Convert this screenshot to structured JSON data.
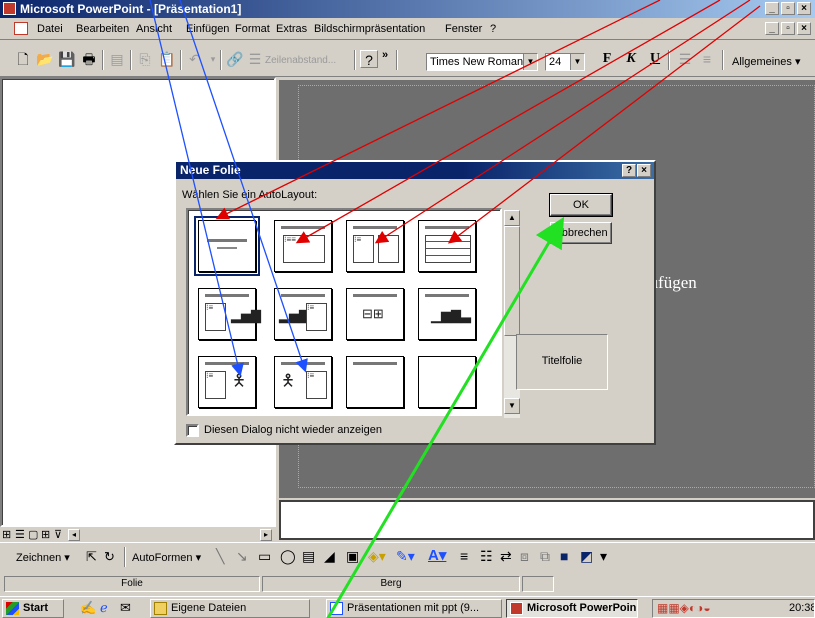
{
  "window": {
    "title": "Microsoft PowerPoint - [Präsentation1]",
    "controls": [
      "_",
      "▫",
      "×"
    ]
  },
  "menubar": {
    "items": [
      {
        "label": "Datei"
      },
      {
        "label": "Bearbeiten"
      },
      {
        "label": "Ansicht"
      },
      {
        "label": "Einfügen"
      },
      {
        "label": "Format"
      },
      {
        "label": "Extras"
      },
      {
        "label": "Bildschirmpräsentation"
      },
      {
        "label": "Fenster"
      },
      {
        "label": "?"
      }
    ]
  },
  "toolbar": {
    "line_spacing_label": "Zeilenabstand...",
    "font_name": "Times New Roman",
    "font_size": "24",
    "bold": "F",
    "italic": "K",
    "underline": "U",
    "general_menu": "Allgemeines ▾",
    "more": "»"
  },
  "slide": {
    "visible_text": "zufügen"
  },
  "dialog": {
    "title": "Neue Folie",
    "help_button": "?",
    "close_button": "×",
    "prompt": "Wählen Sie ein AutoLayout:",
    "ok_label": "OK",
    "cancel_label": "Abbrechen",
    "preview_label": "Titelfolie",
    "checkbox_label": "Diesen Dialog nicht wieder anzeigen",
    "selected_layout": "Titelfolie"
  },
  "drawbar": {
    "zeichnen": "Zeichnen ▾",
    "autoformen": "AutoFormen ▾"
  },
  "statusbar": {
    "left": "Folie",
    "middle": "Berg"
  },
  "taskbar": {
    "start": "Start",
    "tasks": [
      {
        "label": "Eigene Dateien"
      },
      {
        "label": "Präsentationen mit ppt (9..."
      },
      {
        "label": "Microsoft PowerPoin..."
      }
    ],
    "clock": "20:38"
  },
  "colors": {
    "title_gradient_start": "#0a246a",
    "arrow_red": "#e00000",
    "arrow_blue": "#1e50ff",
    "arrow_green": "#22e022"
  }
}
